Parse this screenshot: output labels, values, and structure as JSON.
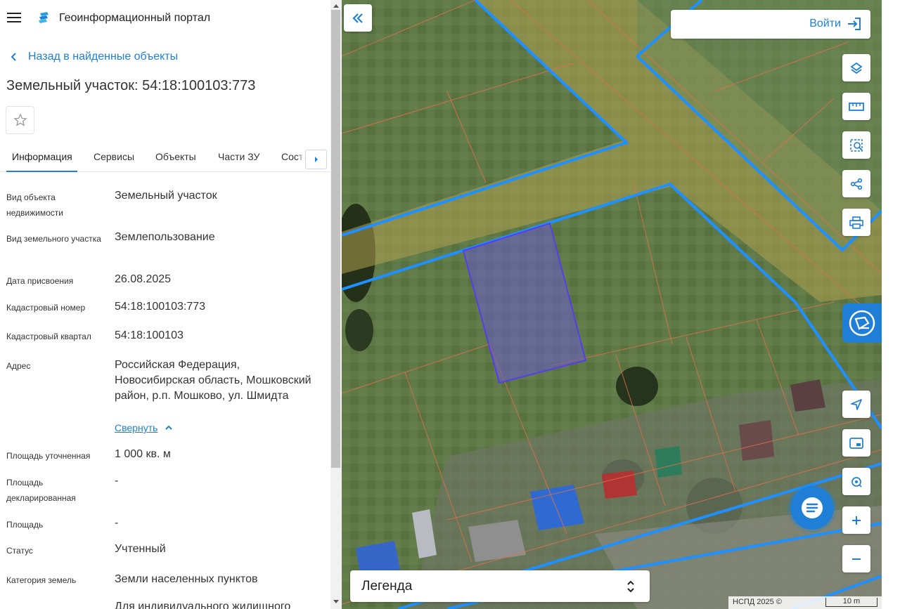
{
  "header": {
    "app_title": "Геоинформационный портал",
    "menu_icon": "hamburger-icon",
    "logo_icon": "portal-logo-icon"
  },
  "navigation": {
    "back_label": "Назад в найденные объекты"
  },
  "object": {
    "title": "Земельный участок: 54:18:100103:773"
  },
  "tabs": [
    {
      "label": "Информация",
      "active": true
    },
    {
      "label": "Сервисы",
      "active": false
    },
    {
      "label": "Объекты",
      "active": false
    },
    {
      "label": "Части ЗУ",
      "active": false
    },
    {
      "label": "Соста",
      "active": false
    }
  ],
  "properties": [
    {
      "label": "Вид объекта недвижимости",
      "value": "Земельный участок"
    },
    {
      "label": "Вид земельного участка",
      "value": "Землепользование"
    },
    {
      "label": "Дата присвоения",
      "value": "26.08.2025"
    },
    {
      "label": "Кадастровый номер",
      "value": "54:18:100103:773"
    },
    {
      "label": "Кадастровый квартал",
      "value": "54:18:100103"
    },
    {
      "label": "Адрес",
      "value": "Российская Федерация, Новосибирская область, Мошковский район, р.п. Мошково, ул. Шмидта"
    },
    {
      "label": "Площадь уточненная",
      "value": "1 000 кв. м"
    },
    {
      "label": "Площадь декларированная",
      "value": "-"
    },
    {
      "label": "Площадь",
      "value": "-"
    },
    {
      "label": "Статус",
      "value": "Учтенный"
    },
    {
      "label": "Категория земель",
      "value": "Земли населенных пунктов"
    },
    {
      "label": "",
      "value": "Для индивидуального жилищного"
    }
  ],
  "address_toggle": "Свернуть",
  "map": {
    "login_label": "Войти",
    "legend_label": "Легенда",
    "attribution": "НСПД 2025 ©",
    "scale_label": "10 m",
    "tools": [
      "layers-icon",
      "ruler-icon",
      "area-select-icon",
      "share-icon",
      "print-icon"
    ],
    "nav_tools": [
      "locate-icon",
      "minimap-icon",
      "geolocation-icon",
      "zoom-in-icon",
      "zoom-out-icon"
    ],
    "colors": {
      "parcel_highlight": "#6a5acd",
      "boundary_blue": "#1e90ff",
      "boundary_red": "#e06040",
      "accent": "#1f7fd6"
    }
  }
}
